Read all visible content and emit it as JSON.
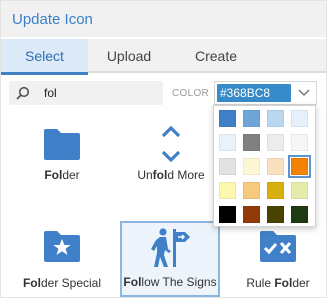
{
  "dialog": {
    "title": "Update Icon"
  },
  "tabs": [
    {
      "label": "Select",
      "active": true
    },
    {
      "label": "Upload",
      "active": false
    },
    {
      "label": "Create",
      "active": false
    }
  ],
  "search": {
    "value": "fol",
    "icon": "search-icon"
  },
  "color": {
    "label": "COLOR",
    "value": "#368BC8",
    "accent": "#368BC8"
  },
  "palette": [
    "#3f80c8",
    "#6fa6da",
    "#b9d7ef",
    "#e6f0fa",
    "#e9f1f9",
    "#808080",
    "#ececec",
    "#f6f6f6",
    "#e2e2e2",
    "#fdf8d4",
    "#fbe0c0",
    "#f28200",
    "#fef7b0",
    "#f7c97e",
    "#d8b00e",
    "#e5eba8",
    "#000000",
    "#943a08",
    "#4a4300",
    "#1e3a10"
  ],
  "palette_selected_index": 11,
  "icons": [
    {
      "name": "folder-icon",
      "label_bold": "Fol",
      "label_rest": "der",
      "selected": false
    },
    {
      "name": "unfold-more-icon",
      "label_pre": "Un",
      "label_bold": "fol",
      "label_rest": "d More",
      "selected": false
    },
    {
      "name": "folder-special-icon",
      "label_bold": "Fol",
      "label_rest": "der Special",
      "selected": false
    },
    {
      "name": "follow-the-signs-icon",
      "label_bold": "Fol",
      "label_rest": "low The Signs",
      "selected": true
    },
    {
      "name": "rule-folder-icon",
      "label_pre": "Rule ",
      "label_bold": "Fol",
      "label_rest": "der",
      "selected": false
    }
  ]
}
